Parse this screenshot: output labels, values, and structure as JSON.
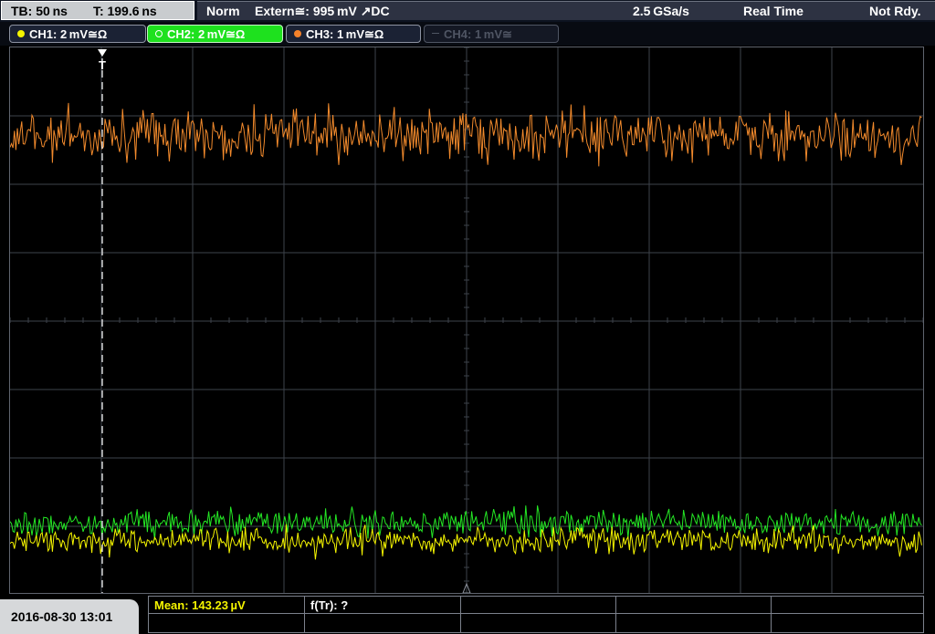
{
  "topbar": {
    "timebase": "TB: 50 ns",
    "trigger_time": "T: 199.6 ns",
    "trigger_mode": "Norm",
    "trigger_source": "Extern≅: 995 mV ↗DC",
    "sample_rate": "2.5 GSa/s",
    "acq_mode": "Real Time",
    "status": "Not Rdy."
  },
  "channels": [
    {
      "label": "CH1: 2 mV≅Ω",
      "color": "#f5f500",
      "active": false
    },
    {
      "label": "CH2: 2 mV≅Ω",
      "color": "#2bea2b",
      "active": true
    },
    {
      "label": "CH3: 1 mV≅Ω",
      "color": "#f5822a",
      "active": false
    },
    {
      "label": "CH4: 1 mV≅",
      "color": "#4f5563",
      "active": false
    }
  ],
  "trigger_marker": "T",
  "colors": {
    "ch1": "#f5f500",
    "ch2": "#24e824",
    "ch3": "#f28a2c",
    "grid": "#3e434b"
  },
  "footer": {
    "datetime": "2016-08-30 13:01",
    "measurements": [
      "Mean: 143.23 µV",
      "f(Tr): ?"
    ]
  }
}
